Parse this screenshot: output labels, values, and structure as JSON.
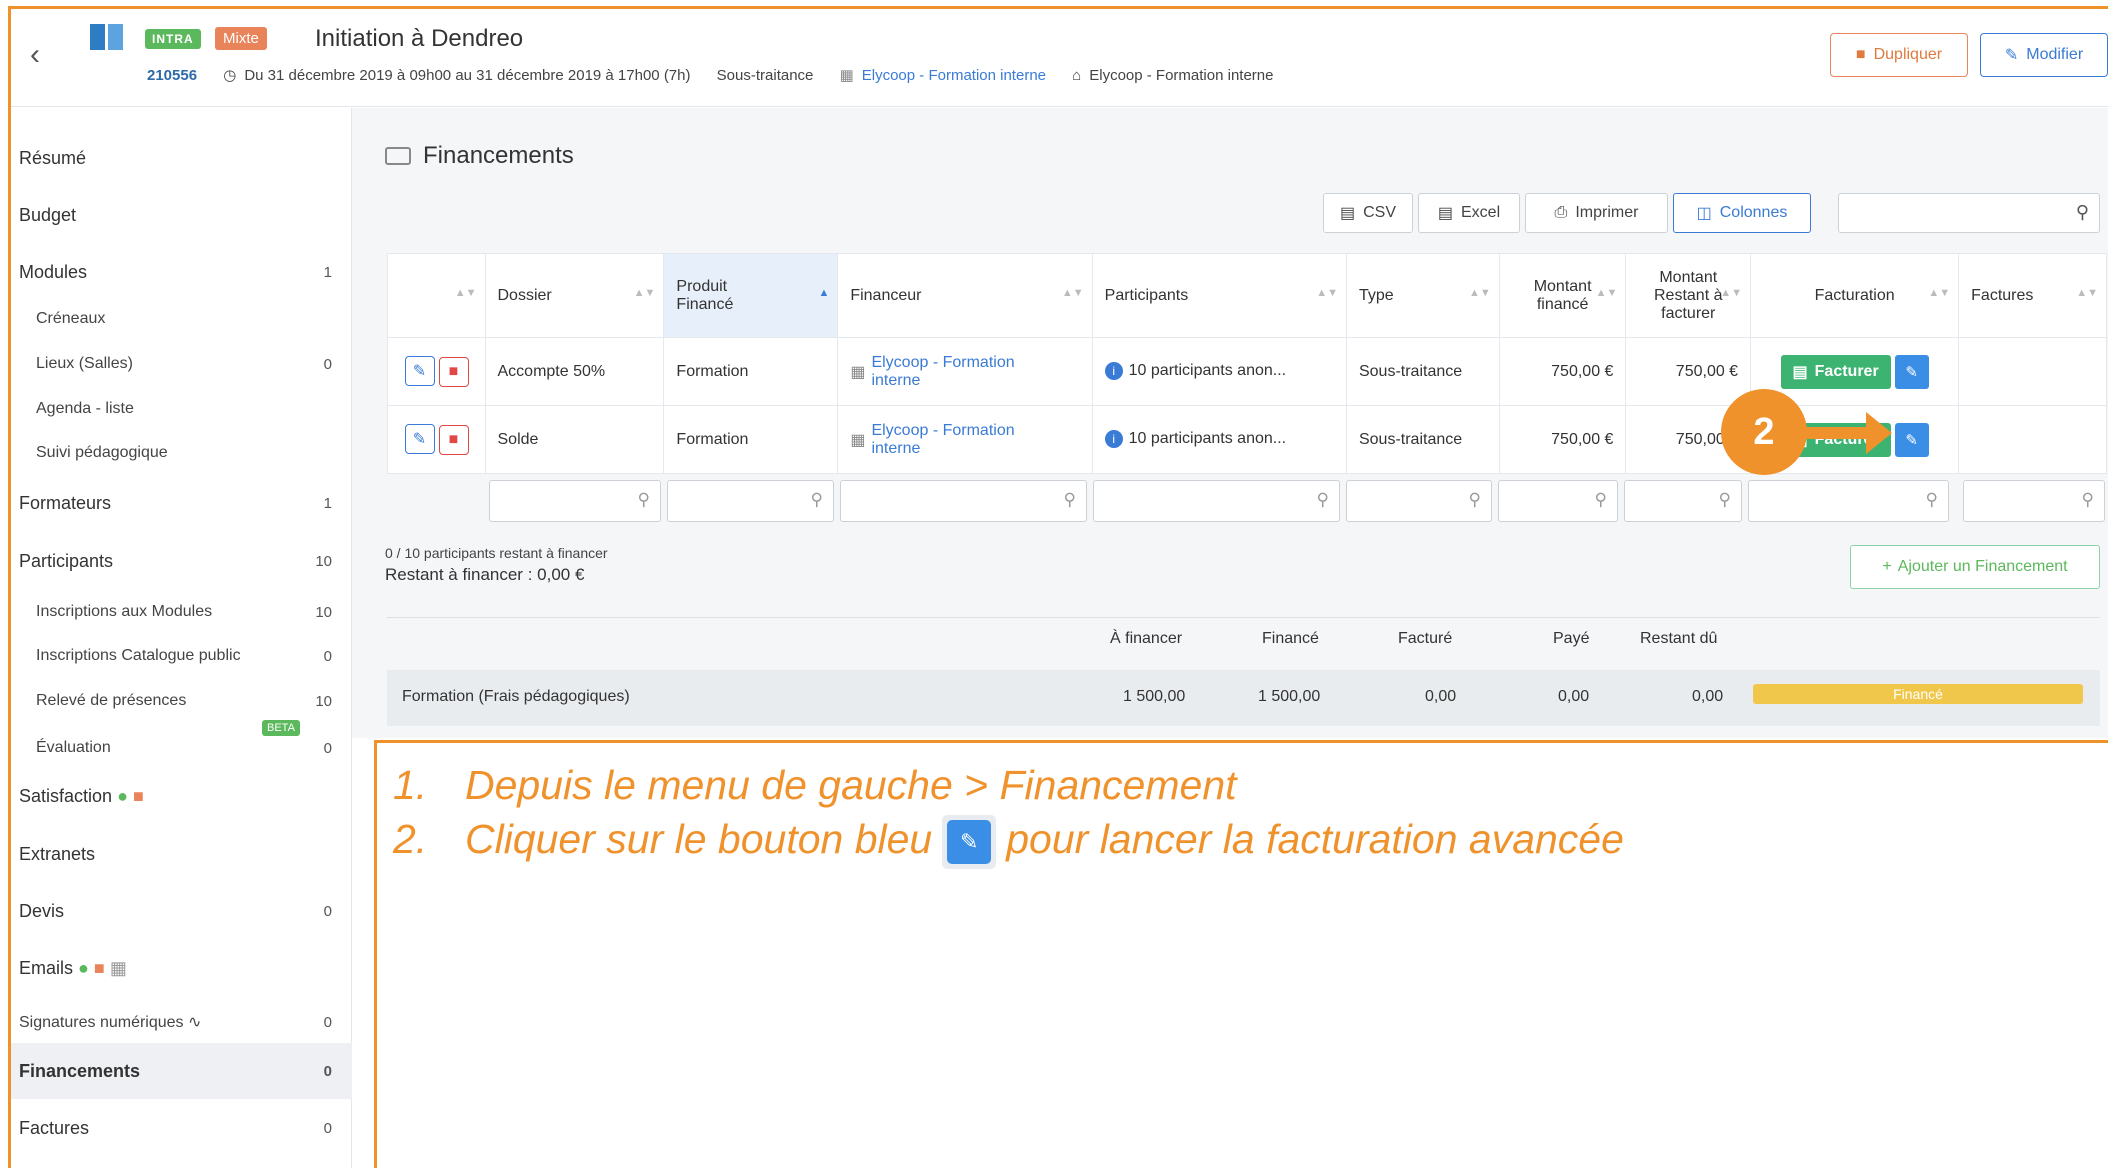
{
  "header": {
    "tag_intra": "INTRA",
    "tag_mixte": "Mixte",
    "title": "Initiation à Dendreo",
    "id": "210556",
    "dates": "Du 31 décembre 2019 à 09h00 au 31 décembre 2019 à 17h00 (7h)",
    "type": "Sous-traitance",
    "client": "Elycoop - Formation interne",
    "location": "Elycoop - Formation interne",
    "btn_duplicate": "Dupliquer",
    "btn_modify": "Modifier"
  },
  "sidebar": {
    "items": [
      {
        "label": "Résumé",
        "count": ""
      },
      {
        "label": "Budget",
        "count": ""
      },
      {
        "label": "Modules",
        "count": "1"
      },
      {
        "label": "Créneaux",
        "count": ""
      },
      {
        "label": "Lieux (Salles)",
        "count": "0"
      },
      {
        "label": "Agenda - liste",
        "count": ""
      },
      {
        "label": "Suivi pédagogique",
        "count": ""
      },
      {
        "label": "Formateurs",
        "count": "1"
      },
      {
        "label": "Participants",
        "count": "10"
      },
      {
        "label": "Inscriptions aux Modules",
        "count": "10"
      },
      {
        "label": "Inscriptions Catalogue public",
        "count": "0"
      },
      {
        "label": "Relevé de présences",
        "count": "10"
      },
      {
        "label": "Évaluation",
        "count": "0"
      },
      {
        "label": "Satisfaction",
        "count": ""
      },
      {
        "label": "Extranets",
        "count": ""
      },
      {
        "label": "Devis",
        "count": "0"
      },
      {
        "label": "Emails",
        "count": ""
      },
      {
        "label": "Signatures numériques",
        "count": "0"
      },
      {
        "label": "Financements",
        "count": "0"
      },
      {
        "label": "Factures",
        "count": "0"
      }
    ],
    "beta": "BETA"
  },
  "main": {
    "section_title": "Financements",
    "toolbar": {
      "csv": "CSV",
      "excel": "Excel",
      "print": "Imprimer",
      "columns": "Colonnes"
    },
    "table": {
      "headers": [
        "Dossier",
        "Produit Financé",
        "Financeur",
        "Participants",
        "Type",
        "Montant financé",
        "Montant Restant à facturer",
        "Facturation",
        "Factures"
      ],
      "rows": [
        {
          "dossier": "Accompte 50%",
          "produit": "Formation",
          "financeur": "Elycoop - Formation interne",
          "participants": "10 participants anon...",
          "type": "Sous-traitance",
          "montant": "750,00 €",
          "restant": "750,00 €",
          "facturer": "Facturer"
        },
        {
          "dossier": "Solde",
          "produit": "Formation",
          "financeur": "Elycoop - Formation interne",
          "participants": "10 participants anon...",
          "type": "Sous-traitance",
          "montant": "750,00 €",
          "restant": "750,00 €",
          "facturer": "Facturer"
        }
      ]
    },
    "remaining_small": "0 / 10 participants restant à financer",
    "remaining_big": "Restant à financer : 0,00 €",
    "add_button": "Ajouter un Financement",
    "summary": {
      "headers": [
        "À financer",
        "Financé",
        "Facturé",
        "Payé",
        "Restant dû"
      ],
      "label": "Formation (Frais pédagogiques)",
      "values": [
        "1 500,00",
        "1 500,00",
        "0,00",
        "0,00",
        "0,00"
      ],
      "status": "Financé"
    }
  },
  "annotation": {
    "line1_num": "1.",
    "line1": "Depuis le menu de gauche > Financement",
    "line2_num": "2.",
    "line2_before": "Cliquer sur le bouton bleu",
    "line2_after": "pour lancer la facturation avancée",
    "marker": "2"
  },
  "colors": {
    "accent_orange": "#f0922c",
    "blue": "#3a7bd5",
    "green": "#3cb371"
  }
}
